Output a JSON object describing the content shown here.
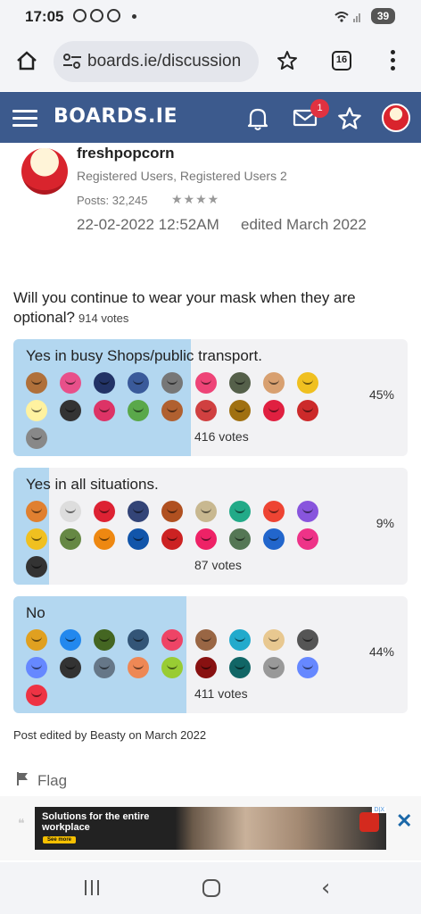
{
  "status_bar": {
    "time": "17:05",
    "battery": "39"
  },
  "browser": {
    "url": "boards.ie/discussion",
    "tab_count": "16"
  },
  "site": {
    "logo": "BOARDS.IE",
    "notification_badge": "1"
  },
  "post": {
    "username": "freshpopcorn",
    "roles": "Registered Users, Registered Users 2",
    "posts": "Posts: 32,245",
    "rank_stars": "★★★★",
    "date": "22-02-2022 12:52AM",
    "edited": "edited March 2022"
  },
  "poll": {
    "question": "Will you continue to wear your mask when they are optional?",
    "total_votes": "914 votes",
    "options": [
      {
        "label": "Yes in busy Shops/public transport.",
        "votes": "416 votes",
        "percent": "45%",
        "share": 0.45,
        "avatar_colors": [
          "#b0703a",
          "#e8508a",
          "#223366",
          "#3a5a9a",
          "#777777",
          "#ee4477",
          "#55604a",
          "#d8a070",
          "#f0c020",
          "#fff2a0",
          "#333333",
          "#dd3366",
          "#5aa84a",
          "#b06030",
          "#d04040",
          "#a07010",
          "#e02040",
          "#cc2a2a",
          "#888888",
          "#2266cc"
        ]
      },
      {
        "label": "Yes in all situations.",
        "votes": "87 votes",
        "percent": "9%",
        "share": 0.09,
        "avatar_colors": [
          "#e08030",
          "#dddddd",
          "#dd2233",
          "#334477",
          "#b05020",
          "#c8b890",
          "#22aa88",
          "#ee4433",
          "#8855dd",
          "#f0c020",
          "#668844",
          "#ee8811",
          "#1155aa",
          "#cc2222",
          "#ee2266",
          "#557755",
          "#2266cc",
          "#ee3388",
          "#333333",
          "#558800"
        ]
      },
      {
        "label": "No",
        "votes": "411 votes",
        "percent": "44%",
        "share": 0.44,
        "avatar_colors": [
          "#e0a020",
          "#2288ee",
          "#446622",
          "#335577",
          "#ee4466",
          "#996644",
          "#22aacc",
          "#e8c890",
          "#555555",
          "#6688ff",
          "#333333",
          "#667788",
          "#ee8855",
          "#99cc33",
          "#881111",
          "#116666",
          "#999999",
          "#6688ff",
          "#ee3344",
          "#444444"
        ]
      }
    ]
  },
  "post_edited": "Post edited by Beasty on March 2022",
  "flag_label": "Flag",
  "ad": {
    "headline": "Solutions for the entire workplace",
    "cta": "See more",
    "tag": "D|X"
  }
}
